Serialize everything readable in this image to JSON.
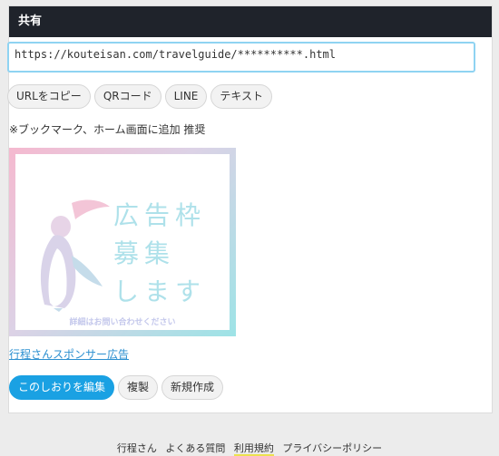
{
  "header": {
    "title": "共有"
  },
  "share": {
    "url": "https://kouteisan.com/travelguide/**********.html",
    "buttons": [
      "URLをコピー",
      "QRコード",
      "LINE",
      "テキスト"
    ],
    "note": "※ブックマーク、ホーム画面に追加 推奨"
  },
  "ad": {
    "lines": [
      "広告枠",
      "募集",
      "します"
    ],
    "sub": "詳細はお問い合わせください",
    "sponsor_link": "行程さんスポンサー広告"
  },
  "actions": {
    "edit": "このしおりを編集",
    "copy": "複製",
    "new": "新規作成"
  },
  "footer": {
    "links": [
      "行程さん",
      "よくある質問",
      "利用規約",
      "プライバシーポリシー"
    ]
  },
  "colors": {
    "header_bg": "#1f232b",
    "accent": "#1aa1e3",
    "link": "#2b8fd0"
  }
}
